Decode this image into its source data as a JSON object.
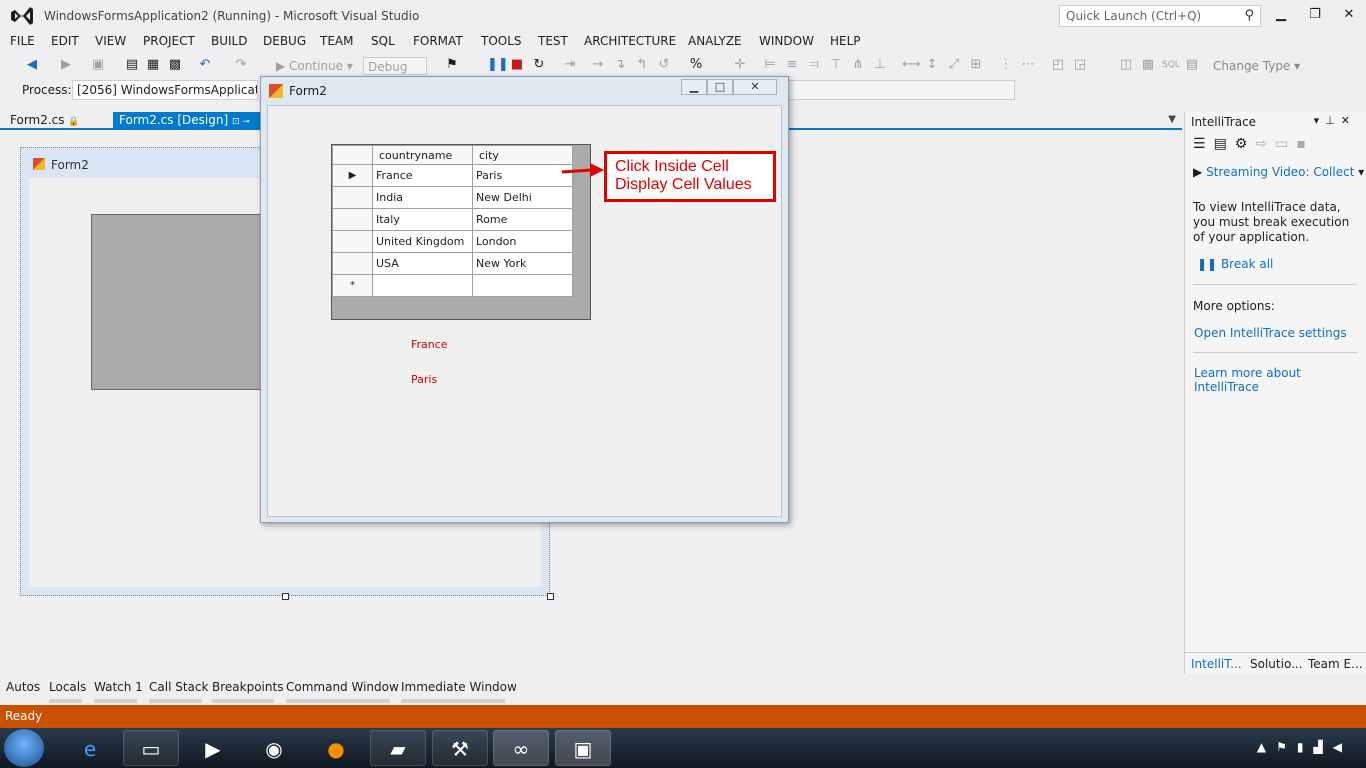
{
  "window": {
    "title": "WindowsFormsApplication2 (Running) - Microsoft Visual Studio",
    "quick_launch_placeholder": "Quick Launch (Ctrl+Q)",
    "min": "▁",
    "restore": "❐",
    "close": "✕"
  },
  "menu": [
    "FILE",
    "EDIT",
    "VIEW",
    "PROJECT",
    "BUILD",
    "DEBUG",
    "TEAM",
    "SQL",
    "FORMAT",
    "TOOLS",
    "TEST",
    "ARCHITECTURE",
    "ANALYZE",
    "WINDOW",
    "HELP"
  ],
  "toolbar": {
    "continue_label": "Continue",
    "config_label": "Debug",
    "change_type_label": "Change Type"
  },
  "process": {
    "label": "Process:",
    "value": "[2056] WindowsFormsApplication2"
  },
  "doc_tabs": {
    "tab1": "Form2.cs",
    "tab2": "Form2.cs [Design]"
  },
  "designer": {
    "form_title": "Form2"
  },
  "running_form": {
    "title": "Form2",
    "grid": {
      "columns": [
        "countryname",
        "city"
      ],
      "rows": [
        [
          "France",
          "Paris"
        ],
        [
          "India",
          "New Delhi"
        ],
        [
          "Italy",
          "Rome"
        ],
        [
          "United Kingdom",
          "London"
        ],
        [
          "USA",
          "New York"
        ]
      ],
      "new_row_marker": "*",
      "current_row_marker": "▶"
    },
    "label_country": "France",
    "label_city": "Paris"
  },
  "annotation": {
    "line1": "Click Inside Cell",
    "line2": "Display Cell Values",
    "color": "#e00000"
  },
  "intellitrace": {
    "header": "IntelliTrace",
    "streaming": "Streaming Video: Collect",
    "info": "To view IntelliTrace data, you must break execution of your application.",
    "break_all": "Break all",
    "more_options": "More options:",
    "open_settings": "Open IntelliTrace settings",
    "learn_more": "Learn more about IntelliTrace",
    "bottom_tabs": [
      "IntelliT...",
      "Solutio...",
      "Team E..."
    ]
  },
  "bottom_tabs": [
    "Autos",
    "Locals",
    "Watch 1",
    "Call Stack",
    "Breakpoints",
    "Command Window",
    "Immediate Window"
  ],
  "status": {
    "text": "Ready",
    "bar_color": "#ca5100"
  }
}
